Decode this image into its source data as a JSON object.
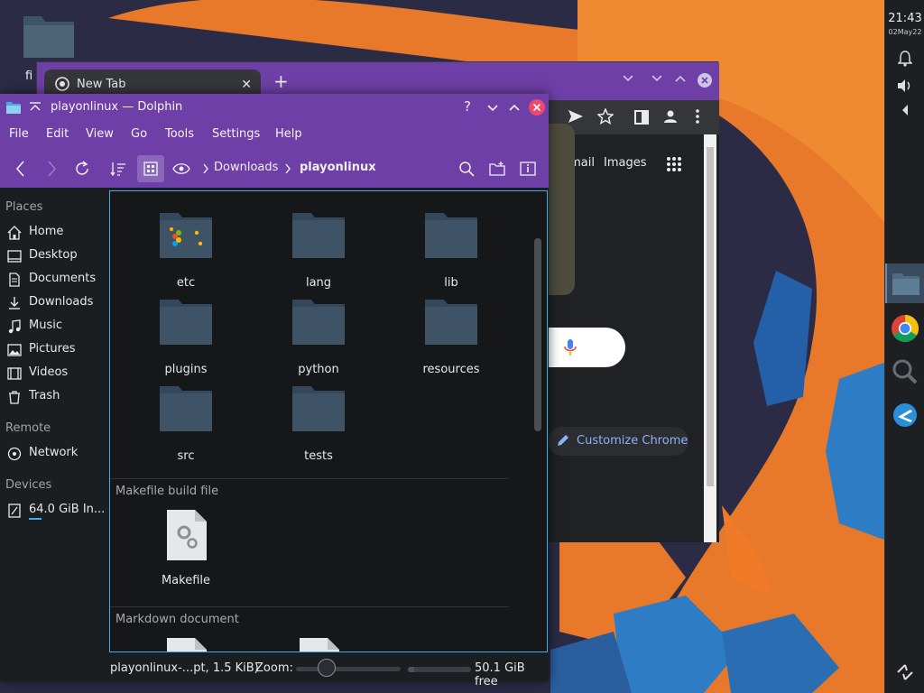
{
  "desktop": {
    "icon_label": "fi"
  },
  "panel": {
    "time": "21:43",
    "date": "02May22",
    "icons": [
      "bell-icon",
      "volume-icon",
      "arrow-left-icon",
      "dolphin-task-icon",
      "chrome-task-icon",
      "search-task-icon",
      "app-task-icon",
      "assistant-icon"
    ]
  },
  "chrome": {
    "tab_title": "New Tab",
    "links": {
      "gmail": "Gmail",
      "images": "Images"
    },
    "customize_label": "Customize Chrome"
  },
  "dolphin": {
    "title": "playonlinux — Dolphin",
    "menu": [
      "File",
      "Edit",
      "View",
      "Go",
      "Tools",
      "Settings",
      "Help"
    ],
    "breadcrumb": [
      "Downloads",
      "playonlinux"
    ],
    "places": {
      "header": "Places",
      "items": [
        {
          "label": "Home",
          "icon": "home-icon"
        },
        {
          "label": "Desktop",
          "icon": "desktop-icon"
        },
        {
          "label": "Documents",
          "icon": "documents-icon"
        },
        {
          "label": "Downloads",
          "icon": "downloads-icon"
        },
        {
          "label": "Music",
          "icon": "music-icon"
        },
        {
          "label": "Pictures",
          "icon": "pictures-icon"
        },
        {
          "label": "Videos",
          "icon": "videos-icon"
        },
        {
          "label": "Trash",
          "icon": "trash-icon"
        }
      ],
      "remote_header": "Remote",
      "remote_items": [
        {
          "label": "Network",
          "icon": "network-icon"
        }
      ],
      "devices_header": "Devices",
      "device_items": [
        {
          "label": "64.0 GiB In...",
          "icon": "drive-icon"
        }
      ]
    },
    "folders": [
      "etc",
      "lang",
      "lib",
      "plugins",
      "python",
      "resources",
      "src",
      "tests"
    ],
    "groups": [
      {
        "header": "Makefile build file",
        "files": [
          "Makefile"
        ]
      },
      {
        "header": "Markdown document",
        "files": [
          "",
          ""
        ]
      }
    ],
    "status": {
      "file": "playonlinux-...pt, 1.5 KiB)",
      "zoom_label": "Zoom:",
      "zoom_level": 0.25,
      "free": "50.1 GiB free",
      "used_fraction": 0.1
    },
    "colors": {
      "accent": "#6e3fa6",
      "selection": "#3daee9",
      "folder": "#3e5466"
    }
  }
}
